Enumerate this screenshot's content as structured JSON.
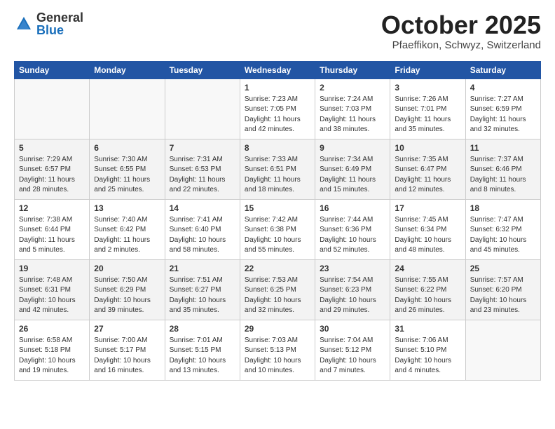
{
  "logo": {
    "general": "General",
    "blue": "Blue"
  },
  "title": "October 2025",
  "location": "Pfaeffikon, Schwyz, Switzerland",
  "days_of_week": [
    "Sunday",
    "Monday",
    "Tuesday",
    "Wednesday",
    "Thursday",
    "Friday",
    "Saturday"
  ],
  "weeks": [
    {
      "shade": false,
      "days": [
        {
          "num": "",
          "info": ""
        },
        {
          "num": "",
          "info": ""
        },
        {
          "num": "",
          "info": ""
        },
        {
          "num": "1",
          "info": "Sunrise: 7:23 AM\nSunset: 7:05 PM\nDaylight: 11 hours\nand 42 minutes."
        },
        {
          "num": "2",
          "info": "Sunrise: 7:24 AM\nSunset: 7:03 PM\nDaylight: 11 hours\nand 38 minutes."
        },
        {
          "num": "3",
          "info": "Sunrise: 7:26 AM\nSunset: 7:01 PM\nDaylight: 11 hours\nand 35 minutes."
        },
        {
          "num": "4",
          "info": "Sunrise: 7:27 AM\nSunset: 6:59 PM\nDaylight: 11 hours\nand 32 minutes."
        }
      ]
    },
    {
      "shade": true,
      "days": [
        {
          "num": "5",
          "info": "Sunrise: 7:29 AM\nSunset: 6:57 PM\nDaylight: 11 hours\nand 28 minutes."
        },
        {
          "num": "6",
          "info": "Sunrise: 7:30 AM\nSunset: 6:55 PM\nDaylight: 11 hours\nand 25 minutes."
        },
        {
          "num": "7",
          "info": "Sunrise: 7:31 AM\nSunset: 6:53 PM\nDaylight: 11 hours\nand 22 minutes."
        },
        {
          "num": "8",
          "info": "Sunrise: 7:33 AM\nSunset: 6:51 PM\nDaylight: 11 hours\nand 18 minutes."
        },
        {
          "num": "9",
          "info": "Sunrise: 7:34 AM\nSunset: 6:49 PM\nDaylight: 11 hours\nand 15 minutes."
        },
        {
          "num": "10",
          "info": "Sunrise: 7:35 AM\nSunset: 6:47 PM\nDaylight: 11 hours\nand 12 minutes."
        },
        {
          "num": "11",
          "info": "Sunrise: 7:37 AM\nSunset: 6:46 PM\nDaylight: 11 hours\nand 8 minutes."
        }
      ]
    },
    {
      "shade": false,
      "days": [
        {
          "num": "12",
          "info": "Sunrise: 7:38 AM\nSunset: 6:44 PM\nDaylight: 11 hours\nand 5 minutes."
        },
        {
          "num": "13",
          "info": "Sunrise: 7:40 AM\nSunset: 6:42 PM\nDaylight: 11 hours\nand 2 minutes."
        },
        {
          "num": "14",
          "info": "Sunrise: 7:41 AM\nSunset: 6:40 PM\nDaylight: 10 hours\nand 58 minutes."
        },
        {
          "num": "15",
          "info": "Sunrise: 7:42 AM\nSunset: 6:38 PM\nDaylight: 10 hours\nand 55 minutes."
        },
        {
          "num": "16",
          "info": "Sunrise: 7:44 AM\nSunset: 6:36 PM\nDaylight: 10 hours\nand 52 minutes."
        },
        {
          "num": "17",
          "info": "Sunrise: 7:45 AM\nSunset: 6:34 PM\nDaylight: 10 hours\nand 48 minutes."
        },
        {
          "num": "18",
          "info": "Sunrise: 7:47 AM\nSunset: 6:32 PM\nDaylight: 10 hours\nand 45 minutes."
        }
      ]
    },
    {
      "shade": true,
      "days": [
        {
          "num": "19",
          "info": "Sunrise: 7:48 AM\nSunset: 6:31 PM\nDaylight: 10 hours\nand 42 minutes."
        },
        {
          "num": "20",
          "info": "Sunrise: 7:50 AM\nSunset: 6:29 PM\nDaylight: 10 hours\nand 39 minutes."
        },
        {
          "num": "21",
          "info": "Sunrise: 7:51 AM\nSunset: 6:27 PM\nDaylight: 10 hours\nand 35 minutes."
        },
        {
          "num": "22",
          "info": "Sunrise: 7:53 AM\nSunset: 6:25 PM\nDaylight: 10 hours\nand 32 minutes."
        },
        {
          "num": "23",
          "info": "Sunrise: 7:54 AM\nSunset: 6:23 PM\nDaylight: 10 hours\nand 29 minutes."
        },
        {
          "num": "24",
          "info": "Sunrise: 7:55 AM\nSunset: 6:22 PM\nDaylight: 10 hours\nand 26 minutes."
        },
        {
          "num": "25",
          "info": "Sunrise: 7:57 AM\nSunset: 6:20 PM\nDaylight: 10 hours\nand 23 minutes."
        }
      ]
    },
    {
      "shade": false,
      "days": [
        {
          "num": "26",
          "info": "Sunrise: 6:58 AM\nSunset: 5:18 PM\nDaylight: 10 hours\nand 19 minutes."
        },
        {
          "num": "27",
          "info": "Sunrise: 7:00 AM\nSunset: 5:17 PM\nDaylight: 10 hours\nand 16 minutes."
        },
        {
          "num": "28",
          "info": "Sunrise: 7:01 AM\nSunset: 5:15 PM\nDaylight: 10 hours\nand 13 minutes."
        },
        {
          "num": "29",
          "info": "Sunrise: 7:03 AM\nSunset: 5:13 PM\nDaylight: 10 hours\nand 10 minutes."
        },
        {
          "num": "30",
          "info": "Sunrise: 7:04 AM\nSunset: 5:12 PM\nDaylight: 10 hours\nand 7 minutes."
        },
        {
          "num": "31",
          "info": "Sunrise: 7:06 AM\nSunset: 5:10 PM\nDaylight: 10 hours\nand 4 minutes."
        },
        {
          "num": "",
          "info": ""
        }
      ]
    }
  ]
}
